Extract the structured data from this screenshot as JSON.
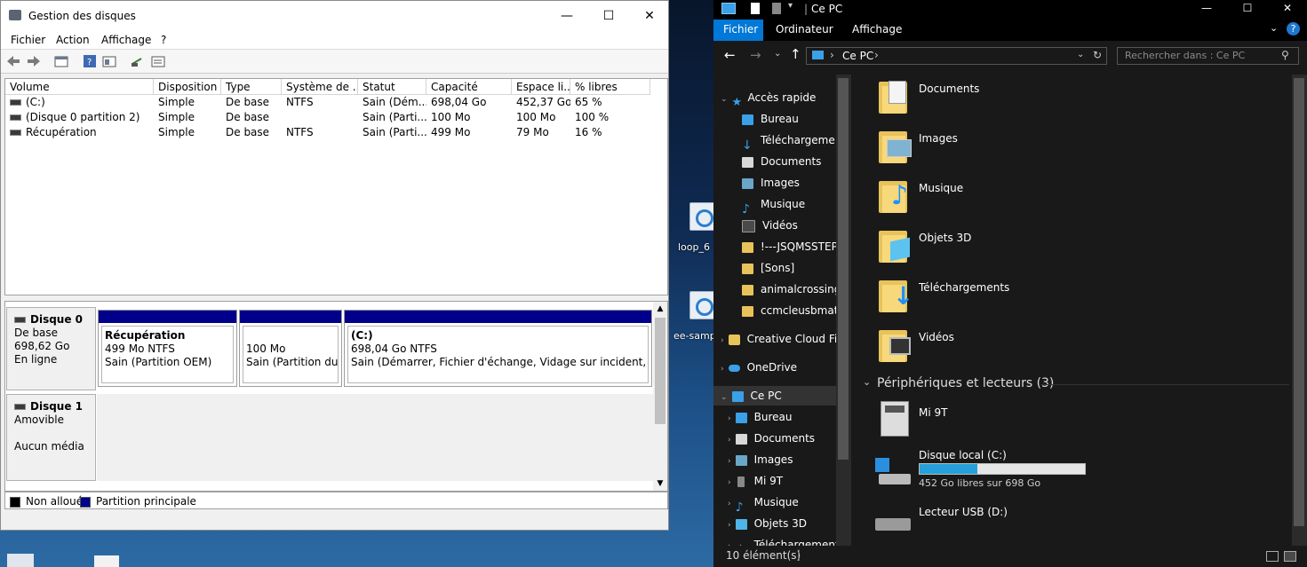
{
  "desktop": {
    "icon1_label": "loop_6",
    "icon2_label": "ee-sampl"
  },
  "disk_mgmt": {
    "title": "Gestion des disques",
    "menu": [
      "Fichier",
      "Action",
      "Affichage",
      "?"
    ],
    "columns": [
      "Volume",
      "Disposition",
      "Type",
      "Système de ...",
      "Statut",
      "Capacité",
      "Espace li...",
      "% libres"
    ],
    "rows": [
      [
        "(C:)",
        "Simple",
        "De base",
        "NTFS",
        "Sain (Dém...",
        "698,04 Go",
        "452,37 Go",
        "65 %"
      ],
      [
        "(Disque 0 partition 2)",
        "Simple",
        "De base",
        "",
        "Sain (Parti...",
        "100 Mo",
        "100 Mo",
        "100 %"
      ],
      [
        "Récupération",
        "Simple",
        "De base",
        "NTFS",
        "Sain (Parti...",
        "499 Mo",
        "79 Mo",
        "16 %"
      ]
    ],
    "disk0": {
      "name": "Disque 0",
      "type": "De base",
      "size": "698,62 Go",
      "state": "En ligne",
      "partitions": [
        {
          "name": "Récupération",
          "size": "499 Mo NTFS",
          "status": "Sain (Partition OEM)"
        },
        {
          "name": "",
          "size": "100 Mo",
          "status": "Sain (Partition du sy"
        },
        {
          "name": "(C:)",
          "size": "698,04 Go NTFS",
          "status": "Sain (Démarrer, Fichier d'échange, Vidage sur incident, Partitior"
        }
      ]
    },
    "disk1": {
      "name": "Disque 1",
      "type": "Amovible",
      "state": "Aucun média"
    },
    "legend": [
      {
        "label": "Non alloué",
        "color": "#000000"
      },
      {
        "label": "Partition principale",
        "color": "#00008b"
      }
    ]
  },
  "explorer": {
    "title": "Ce PC",
    "tabs": [
      "Fichier",
      "Ordinateur",
      "Affichage"
    ],
    "address": "Ce PC",
    "search_placeholder": "Rechercher dans : Ce PC",
    "nav": [
      {
        "label": "Accès rapide",
        "icon": "star-icon",
        "pinned": false
      },
      {
        "label": "Bureau",
        "icon": "desktop-icon",
        "pinned": true
      },
      {
        "label": "Téléchargeme",
        "icon": "download-icon",
        "pinned": true
      },
      {
        "label": "Documents",
        "icon": "document-icon",
        "pinned": true
      },
      {
        "label": "Images",
        "icon": "image-icon",
        "pinned": true
      },
      {
        "label": "Musique",
        "icon": "music-icon",
        "pinned": true
      },
      {
        "label": "Vidéos",
        "icon": "video-icon",
        "pinned": true
      },
      {
        "label": "!---JSQMSSTEP-",
        "icon": "folder-icon",
        "pinned": false
      },
      {
        "label": "[Sons]",
        "icon": "folder-icon",
        "pinned": false
      },
      {
        "label": "animalcrossing",
        "icon": "folder-icon",
        "pinned": false
      },
      {
        "label": "ccmcleusbmath",
        "icon": "folder-icon",
        "pinned": false
      },
      {
        "label": "Creative Cloud Fil",
        "icon": "creative-cloud-icon",
        "pinned": false
      },
      {
        "label": "OneDrive",
        "icon": "cloud-icon",
        "pinned": false
      },
      {
        "label": "Ce PC",
        "icon": "computer-icon",
        "pinned": false
      },
      {
        "label": "Bureau",
        "icon": "desktop-icon",
        "pinned": false
      },
      {
        "label": "Documents",
        "icon": "document-icon",
        "pinned": false
      },
      {
        "label": "Images",
        "icon": "image-icon",
        "pinned": false
      },
      {
        "label": "Mi 9T",
        "icon": "phone-icon",
        "pinned": false
      },
      {
        "label": "Musique",
        "icon": "music-icon",
        "pinned": false
      },
      {
        "label": "Objets 3D",
        "icon": "cube-icon",
        "pinned": false
      },
      {
        "label": "Téléchargement",
        "icon": "download-icon",
        "pinned": false
      }
    ],
    "folders": [
      "Documents",
      "Images",
      "Musique",
      "Objets 3D",
      "Téléchargements",
      "Vidéos"
    ],
    "devices_header": "Périphériques et lecteurs (3)",
    "devices": [
      {
        "name": "Mi 9T",
        "detail": ""
      },
      {
        "name": "Disque local (C:)",
        "detail": "452 Go libres sur 698 Go",
        "used_fraction": 0.352
      },
      {
        "name": "Lecteur USB (D:)",
        "detail": ""
      }
    ],
    "status": "10 élément(s)",
    "accent": "#0078d7"
  }
}
